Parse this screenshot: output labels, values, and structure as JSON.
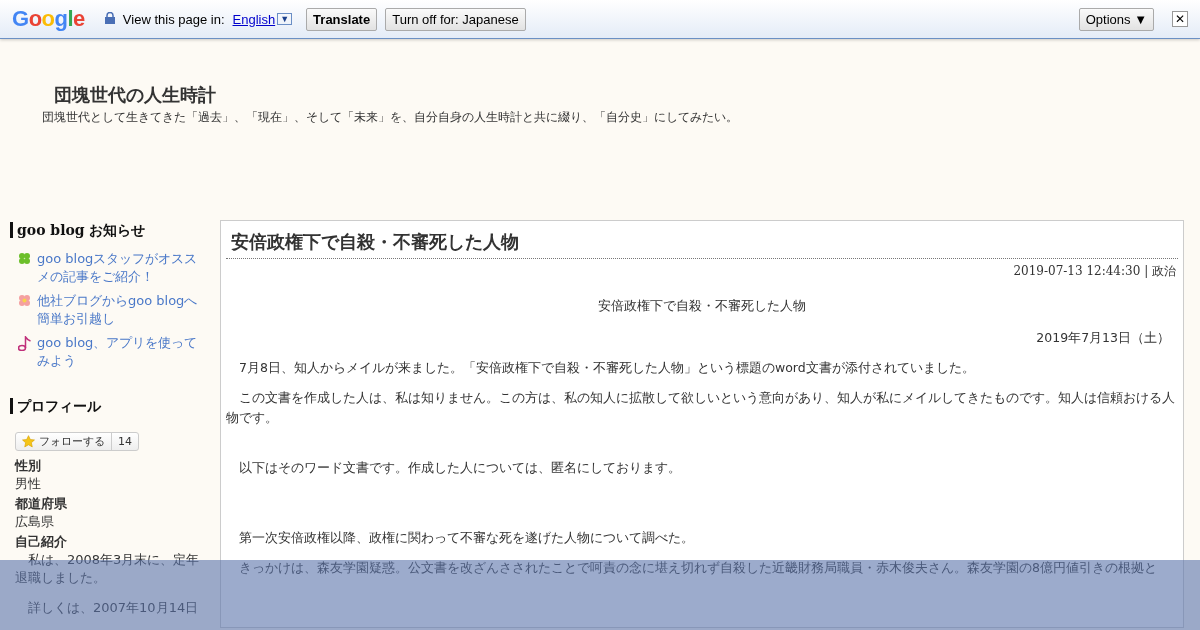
{
  "translate_bar": {
    "logo": "Google",
    "prompt": "View this page in:",
    "language": "English",
    "dropdown": "▼",
    "buttons": [
      {
        "kind": "primary",
        "label": "Translate"
      },
      {
        "kind": "plain",
        "label": "Turn off for: Japanese"
      }
    ],
    "options": "Options ▼",
    "close": "✕"
  },
  "blog": {
    "title": "団塊世代の人生時計",
    "description": "団塊世代として生きてきた「過去」、「現在」、そして「未来」を、自分自身の人生時計と共に綴り、「自分史」にしてみたい。"
  },
  "sidebar": {
    "notice_heading": "goo blog お知らせ",
    "notices": [
      {
        "kind": "clover",
        "text": "goo blogスタッフがオススメの記事をご紹介！"
      },
      {
        "kind": "flower",
        "text": "他社ブログからgoo blogへ簡単お引越し"
      },
      {
        "kind": "note",
        "text": "goo blog、アプリを使ってみよう"
      }
    ],
    "profile_heading": "プロフィール",
    "follow_label": "フォローする",
    "follow_count": "14",
    "fields": [
      {
        "label": "性別",
        "value": "男性"
      },
      {
        "label": "都道府県",
        "value": "広島県"
      },
      {
        "label": "自己紹介",
        "value": "　私は、2008年3月末に、定年退職しました。"
      }
    ],
    "more": "　詳しくは、2007年10月14日"
  },
  "article": {
    "title": "安倍政権下で自殺・不審死した人物",
    "meta": "2019-07-13 12:44:30 | 政治",
    "paragraphs": [
      {
        "kind": "center",
        "text": "安倍政権下で自殺・不審死した人物"
      },
      {
        "kind": "right",
        "text": "2019年7月13日（土）"
      },
      {
        "kind": "body",
        "text": "　7月8日、知人からメイルが来ました。「安倍政権下で自殺・不審死した人物」という標題のword文書が添付されていました。"
      },
      {
        "kind": "body",
        "text": "　この文書を作成した人は、私は知りません。この方は、私の知人に拡散して欲しいという意向があり、知人が私にメイルしてきたものです。知人は信頼おける人物です。"
      },
      {
        "kind": "gap"
      },
      {
        "kind": "body",
        "text": "　以下はそのワード文書です。作成した人については、匿名にしております。"
      },
      {
        "kind": "gap"
      },
      {
        "kind": "gap"
      },
      {
        "kind": "body",
        "text": "　第一次安倍政権以降、政権に関わって不審な死を遂げた人物について調べた。"
      },
      {
        "kind": "body",
        "text": "　きっかけは、森友学園疑惑。公文書を改ざんさされたことで呵責の念に堪え切れず自殺した近畿財務局職員・赤木俊夫さん。森友学園の8億円値引きの根拠と"
      }
    ]
  }
}
